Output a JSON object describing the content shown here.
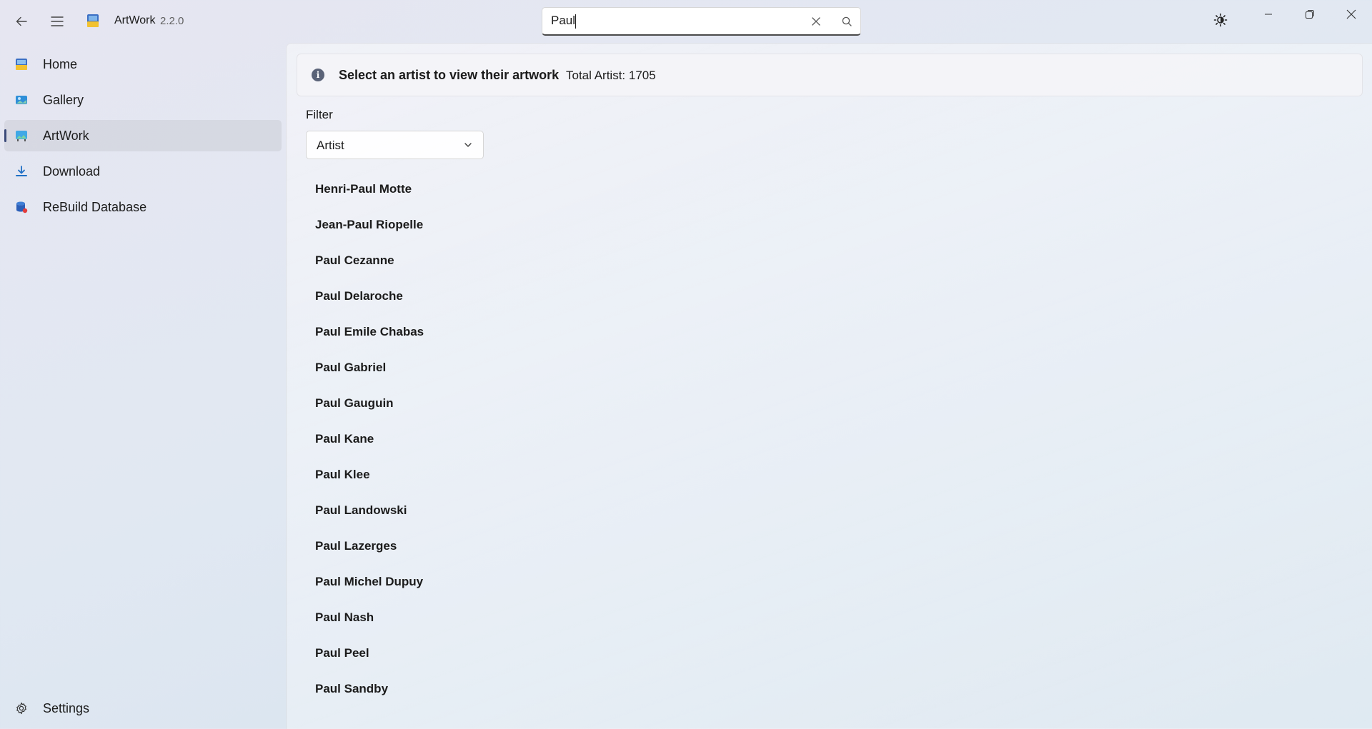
{
  "titlebar": {
    "app_title": "ArtWork",
    "app_version": "2.2.0",
    "search_value": "Paul",
    "icons": {
      "back": "back-arrow-icon",
      "menu": "hamburger-menu-icon",
      "clear": "close-icon",
      "search": "search-icon",
      "theme": "theme-toggle-icon",
      "minimize": "minimize-icon",
      "maximize": "maximize-icon",
      "close": "close-window-icon"
    }
  },
  "sidebar": {
    "items": [
      {
        "label": "Home",
        "icon": "home-icon"
      },
      {
        "label": "Gallery",
        "icon": "gallery-icon"
      },
      {
        "label": "ArtWork",
        "icon": "artwork-icon",
        "selected": true
      },
      {
        "label": "Download",
        "icon": "download-icon"
      },
      {
        "label": "ReBuild Database",
        "icon": "database-icon"
      }
    ],
    "settings_label": "Settings"
  },
  "main": {
    "info_title": "Select an artist to view their artwork",
    "info_message": "Total Artist: 1705",
    "filter_label": "Filter",
    "filter_value": "Artist",
    "artists": [
      "Henri-Paul Motte",
      "Jean-Paul Riopelle",
      "Paul Cezanne",
      "Paul Delaroche",
      "Paul Emile Chabas",
      "Paul Gabriel",
      "Paul Gauguin",
      "Paul Kane",
      "Paul Klee",
      "Paul Landowski",
      "Paul Lazerges",
      "Paul Michel Dupuy",
      "Paul Nash",
      "Paul Peel",
      "Paul Sandby"
    ]
  },
  "colors": {
    "accent": "#3b4a7a",
    "text": "#1b1b1b",
    "secondary_text": "#616161"
  }
}
